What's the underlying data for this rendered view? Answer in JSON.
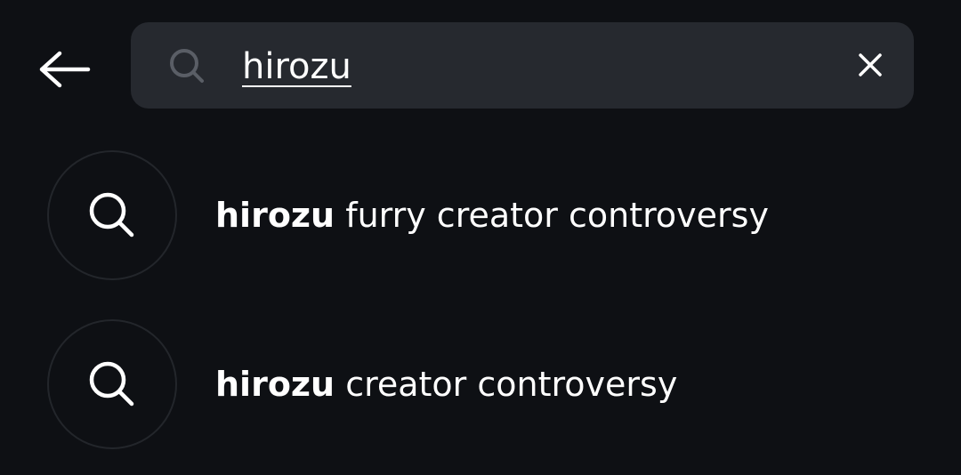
{
  "search": {
    "value": "hirozu",
    "back_icon": "arrow-left-icon",
    "search_icon": "search-icon",
    "clear_icon": "close-icon"
  },
  "suggestions": [
    {
      "query_bold": "hirozu",
      "rest": " furry creator controversy",
      "icon": "search-icon"
    },
    {
      "query_bold": "hirozu",
      "rest": " creator controversy",
      "icon": "search-icon"
    }
  ],
  "colors": {
    "background": "#0e1014",
    "search_bar": "#26292f",
    "text": "#ffffff",
    "muted_icon": "#5a5e66",
    "circle_border": "#23262b"
  }
}
